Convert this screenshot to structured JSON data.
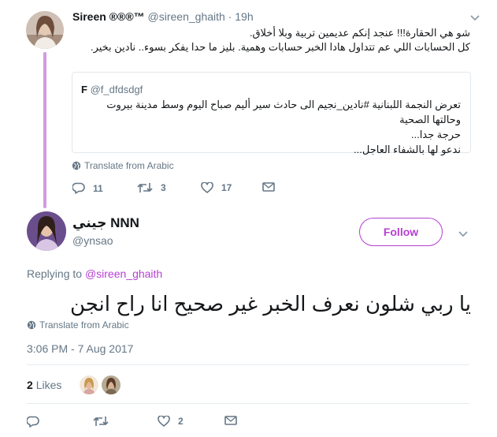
{
  "parent_tweet": {
    "display_name": "Sireen ®®®™",
    "handle": "@sireen_ghaith",
    "separator": "·",
    "time": "19h",
    "text_line1": "شو هي الحقارة!!! عنجد إنكم عديمين تربية وبلا أخلاق.",
    "text_line2": "كل الحسابات اللي عم تتداول هادا الخبر حسابات وهمية. بليز ما حدا يفكر بسوء.. نادين بخير.",
    "quoted": {
      "author": "F",
      "handle": "@f_dfdsdgf",
      "line1": "تعرض النجمة اللبنانية #نادين_نجيم الى حادث سير أليم صباح اليوم وسط مدينة بيروت وحالتها الصحية",
      "line2": "حرجة جدا...",
      "line3": "ندعو لها بالشفاء العاجل..."
    },
    "translate": "Translate from Arabic",
    "reply_count": "11",
    "retweet_count": "3",
    "like_count": "17"
  },
  "main_tweet": {
    "display_name": "جيني NNN",
    "handle": "@ynsao",
    "follow_label": "Follow",
    "replying_prefix": "Replying to",
    "replying_to": "@sireen_ghaith",
    "text": "يا ربي شلون نعرف الخبر غير صحيح انا راح انجن",
    "translate": "Translate from Arabic",
    "timestamp": "3:06 PM - 7 Aug 2017",
    "likes_count": "2",
    "likes_label": "Likes",
    "like_count": "2"
  },
  "colors": {
    "accent": "#b53fd2",
    "thread_line": "#d29ae2",
    "muted": "#657786",
    "text": "#14171a",
    "border": "#e1e8ed"
  },
  "icons": {
    "reply": "reply-icon",
    "retweet": "retweet-icon",
    "like": "heart-icon",
    "message": "envelope-icon",
    "translate": "globe-icon",
    "more": "chevron-down-icon"
  }
}
